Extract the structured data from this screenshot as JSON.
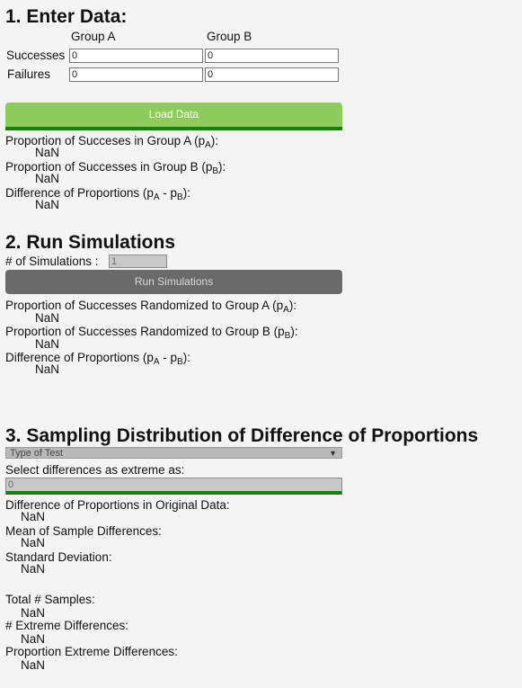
{
  "section1": {
    "title": "1. Enter Data:",
    "group_a": "Group A",
    "group_b": "Group B",
    "successes_label": "Successes",
    "failures_label": "Failures",
    "successes_a": "0",
    "successes_b": "0",
    "failures_a": "0",
    "failures_b": "0",
    "load_button": "Load Data",
    "prop_a_label": "Proportion of Succeses in Group A (p",
    "prop_a_sub": "A",
    "prop_a_end": "):",
    "prop_a_value": "NaN",
    "prop_b_label": "Proportion of Successes in Group B (p",
    "prop_b_sub": "B",
    "prop_b_end": "):",
    "prop_b_value": "NaN",
    "diff_label": "Difference of Proportions (p",
    "diff_sub_a": "A",
    "diff_mid": " - p",
    "diff_sub_b": "B",
    "diff_end": "):",
    "diff_value": "NaN"
  },
  "section2": {
    "title": "2. Run Simulations",
    "num_sims_label": "# of Simulations :",
    "num_sims_value": "1",
    "run_button": "Run Simulations",
    "rand_a_label": "Proportion of Successes Randomized to Group A (p",
    "rand_a_sub": "A",
    "rand_a_end": "):",
    "rand_a_value": "NaN",
    "rand_b_label": "Proportion of Successes Randomized to Group B (p",
    "rand_b_sub": "B",
    "rand_b_end": "):",
    "rand_b_value": "NaN",
    "diff_label": "Difference of Proportions (p",
    "diff_sub_a": "A",
    "diff_mid": " - p",
    "diff_sub_b": "B",
    "diff_end": "):",
    "diff_value": "NaN"
  },
  "section3": {
    "title": "3. Sampling Distribution of Difference of Proportions",
    "test_type_selected": "Type of Test",
    "extreme_label": "Select differences as extreme as:",
    "extreme_value": "0",
    "orig_diff_label": "Difference of Proportions in Original Data:",
    "orig_diff_value": "NaN",
    "mean_label": "Mean of Sample Differences:",
    "mean_value": "NaN",
    "sd_label": "Standard Deviation:",
    "sd_value": "NaN",
    "total_label": "Total # Samples:",
    "total_value": "NaN",
    "extreme_count_label": "# Extreme Differences:",
    "extreme_count_value": "NaN",
    "extreme_prop_label": "Proportion Extreme Differences:",
    "extreme_prop_value": "NaN"
  },
  "colors": {
    "load_button": "#8dcc5a",
    "accent_green": "#1a7d14",
    "run_button": "#6a6a6a",
    "background": "#f4f4f4"
  }
}
